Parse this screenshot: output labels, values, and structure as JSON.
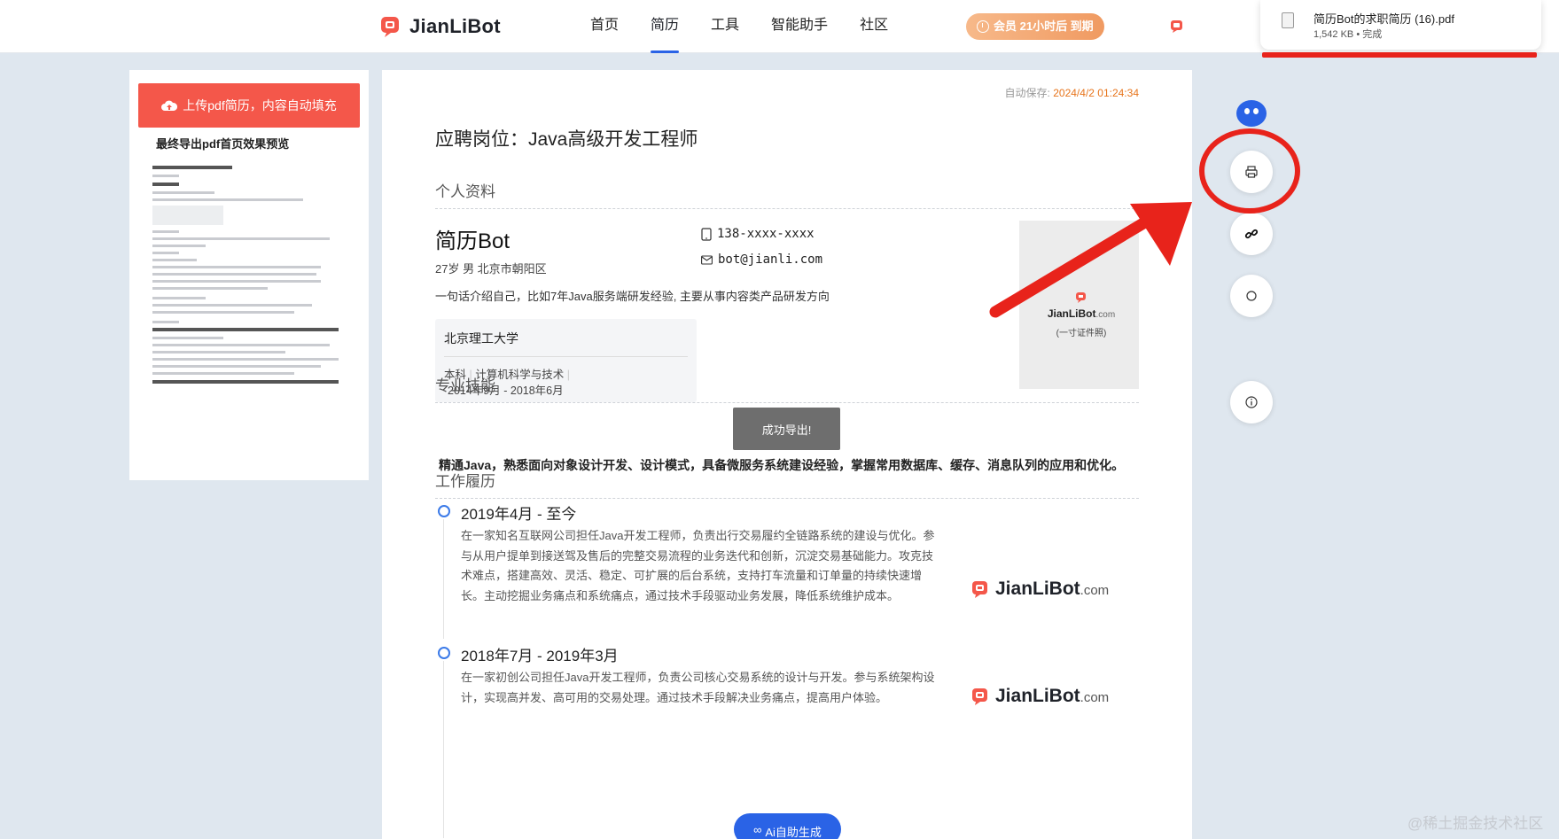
{
  "header": {
    "logo_text": "JianLiBot",
    "nav": [
      "首页",
      "简历",
      "工具",
      "智能助手",
      "社区"
    ],
    "active_nav": "简历",
    "vip_label": "会员 21小时后 到期"
  },
  "download": {
    "filename": "简历Bot的求职简历 (16).pdf",
    "meta": "1,542 KB • 完成"
  },
  "sidebar": {
    "upload_label": "上传pdf简历，内容自动填充",
    "preview_title": "最终导出pdf首页效果预览"
  },
  "resume": {
    "autosave_label": "自动保存:",
    "autosave_time": "2024/4/2 01:24:34",
    "job_title": "应聘岗位：Java高级开发工程师",
    "sections": {
      "profile": "个人资料",
      "skills": "专业技能",
      "work": "工作履历"
    },
    "name": "简历Bot",
    "info": "27岁 男 北京市朝阳区",
    "phone": "138-xxxx-xxxx",
    "email": "bot@jianli.com",
    "intro": "一句话介绍自己，比如7年Java服务端研发经验, 主要从事内容类产品研发方向",
    "education": {
      "school": "北京理工大学",
      "degree": "本科",
      "major": "计算机科学与技术",
      "period": "2014年9月 - 2018年6月"
    },
    "photo": {
      "brand": "JianLiBot",
      "brand_suffix": ".com",
      "caption": "(一寸证件照)"
    },
    "skills_text": "精通Java，熟悉面向对象设计开发、设计模式，具备微服务系统建设经验，掌握常用数据库、缓存、消息队列的应用和优化。",
    "jobs": [
      {
        "period": "2019年4月 - 至今",
        "desc": "在一家知名互联网公司担任Java开发工程师，负责出行交易履约全链路系统的建设与优化。参与从用户提单到接送驾及售后的完整交易流程的业务迭代和创新，沉淀交易基础能力。攻克技术难点，搭建高效、灵活、稳定、可扩展的后台系统，支持打车流量和订单量的持续快速增长。主动挖掘业务痛点和系统痛点，通过技术手段驱动业务发展，降低系统维护成本。"
      },
      {
        "period": "2018年7月 - 2019年3月",
        "desc": "在一家初创公司担任Java开发工程师，负责公司核心交易系统的设计与开发。参与系统架构设计，实现高并发、高可用的交易处理。通过技术手段解决业务痛点，提高用户体验。"
      }
    ],
    "watermark": "JianLiBot",
    "watermark_suffix": ".com"
  },
  "toast": "成功导出!",
  "ai_button": "Ai自助生成",
  "footer_watermark": "@稀土掘金技术社区",
  "colors": {
    "accent": "#2a63e6",
    "brand_red": "#f4574a",
    "annotation_red": "#e8231b",
    "vip_orange": "#f09a61"
  },
  "side_icons": [
    "printer-icon",
    "link-icon",
    "circle-icon",
    "info-icon"
  ]
}
